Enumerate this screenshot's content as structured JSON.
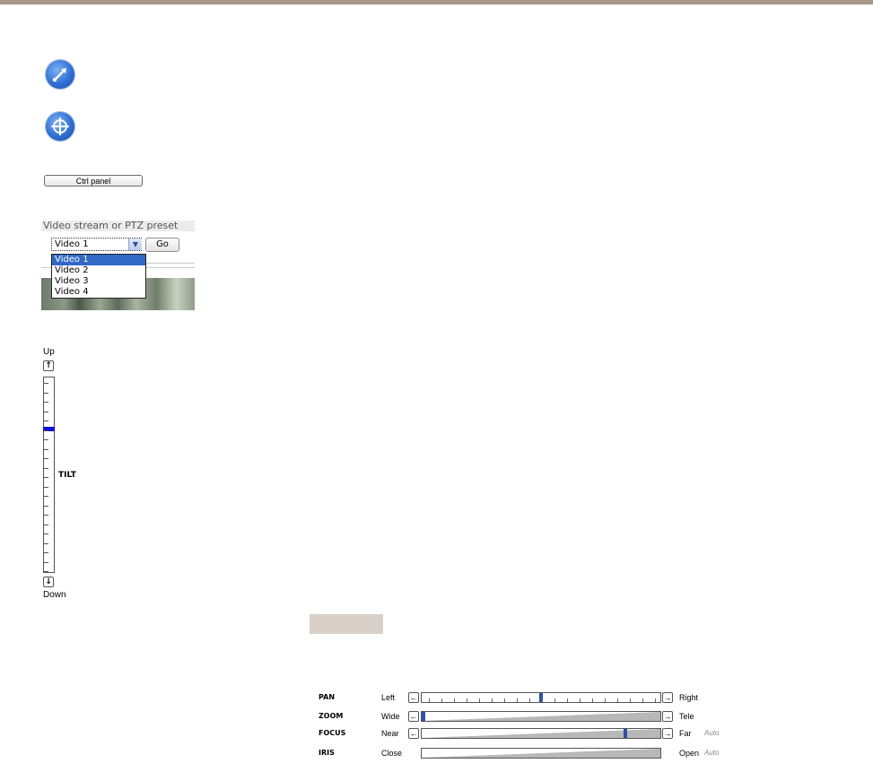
{
  "icons": {
    "top_icon": "joystick-arrow-icon",
    "second_icon": "crosshair-target-icon"
  },
  "controls": {
    "ctrl_panel_label": "Ctrl panel"
  },
  "video_selector": {
    "label": "Video stream or PTZ preset",
    "selected": "Video 1",
    "go_label": "Go",
    "options": [
      "Video 1",
      "Video 2",
      "Video 3",
      "Video 4"
    ]
  },
  "tilt": {
    "up_label": "Up",
    "down_label": "Down",
    "name": "TILT",
    "position_fraction": 0.26
  },
  "ptz": {
    "pan": {
      "name": "PAN",
      "left": "Left",
      "right": "Right",
      "value": 0.5
    },
    "zoom": {
      "name": "ZOOM",
      "left": "Wide",
      "right": "Tele",
      "value": 0.0
    },
    "focus": {
      "name": "FOCUS",
      "left": "Near",
      "right": "Far",
      "auto": "Auto",
      "value": 0.86
    },
    "iris": {
      "name": "IRIS",
      "left": "Close",
      "right": "Open",
      "auto": "Auto"
    }
  },
  "colors": {
    "accent_bar": "#a89888",
    "selection": "#3169c6",
    "tilt_handle": "#1111dd",
    "ptz_handle": "#2c4fb0"
  }
}
